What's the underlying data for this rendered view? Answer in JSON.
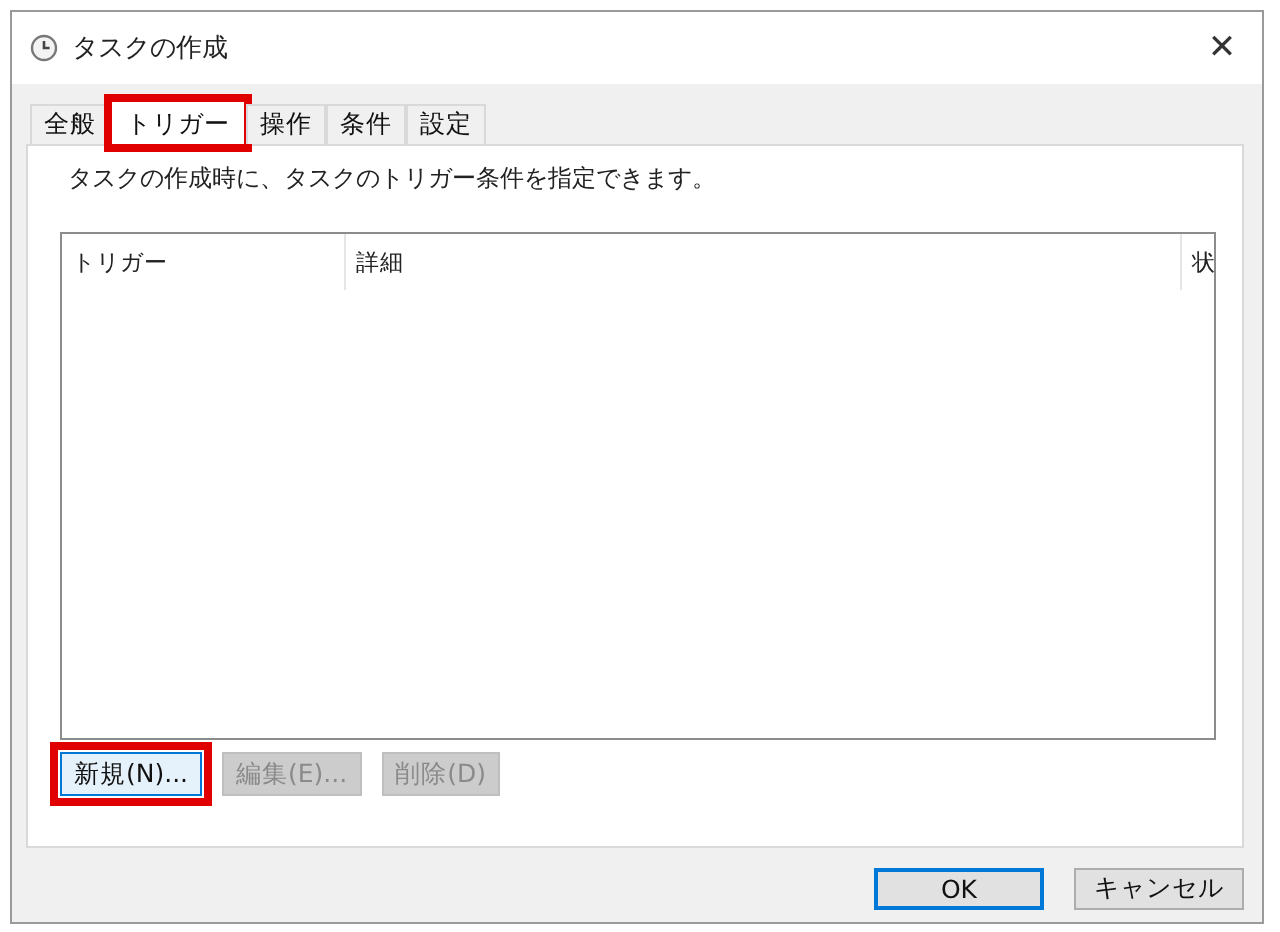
{
  "window": {
    "title": "タスクの作成",
    "close": "✕"
  },
  "tabs": [
    {
      "label": "全般",
      "selected": false,
      "highlighted": false
    },
    {
      "label": "トリガー",
      "selected": true,
      "highlighted": true
    },
    {
      "label": "操作",
      "selected": false,
      "highlighted": false
    },
    {
      "label": "条件",
      "selected": false,
      "highlighted": false
    },
    {
      "label": "設定",
      "selected": false,
      "highlighted": false
    }
  ],
  "description": "タスクの作成時に、タスクのトリガー条件を指定できます。",
  "table": {
    "columns": [
      "トリガー",
      "詳細",
      "状"
    ]
  },
  "list_buttons": [
    {
      "label": "新規(N)...",
      "disabled": false,
      "highlighted": true
    },
    {
      "label": "編集(E)...",
      "disabled": true,
      "highlighted": false
    },
    {
      "label": "削除(D)",
      "disabled": true,
      "highlighted": false
    }
  ],
  "dialog_buttons": [
    {
      "label": "OK",
      "default": true
    },
    {
      "label": "キャンセル",
      "default": false
    }
  ]
}
